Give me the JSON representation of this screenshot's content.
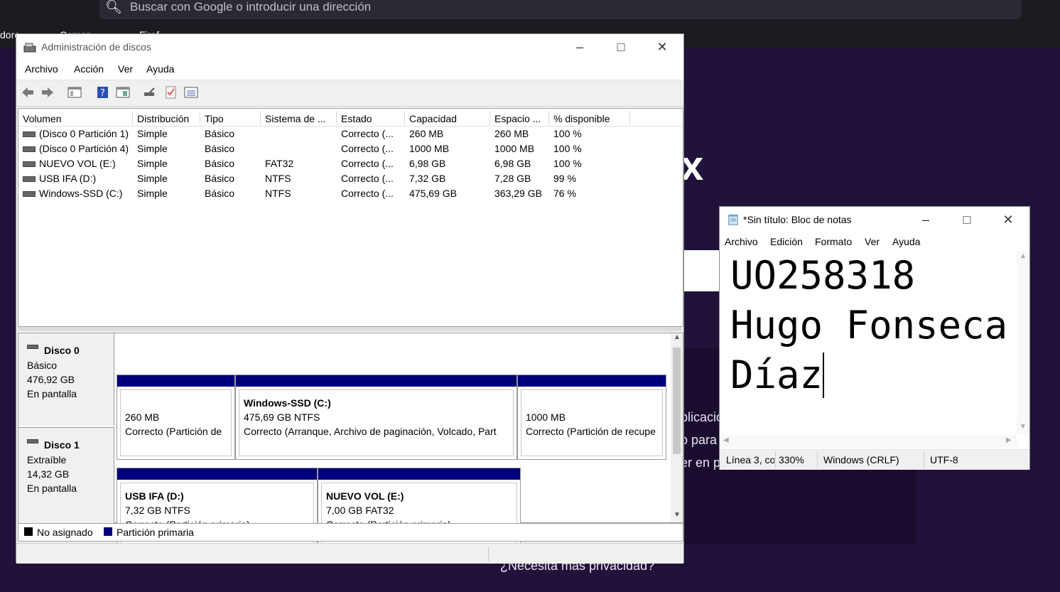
{
  "browser": {
    "search_placeholder": "Buscar con Google o introducir una dirección",
    "bookmark_left": "dore",
    "bookmark_mid": "Comen",
    "bookmark_right": "Firef",
    "bg_letter": "x",
    "bg_line1": "plicació",
    "bg_line2": "o para",
    "bg_line3": "er en p",
    "privacy_text": "¿Necesita más privacidad?"
  },
  "disk_mgmt": {
    "title": "Administración de discos",
    "menu": [
      "Archivo",
      "Acción",
      "Ver",
      "Ayuda"
    ],
    "columns": [
      "Volumen",
      "Distribución",
      "Tipo",
      "Sistema de ...",
      "Estado",
      "Capacidad",
      "Espacio ...",
      "% disponible"
    ],
    "volumes": [
      [
        "(Disco 0 Partición 1)",
        "Simple",
        "Básico",
        "",
        "Correcto (...",
        "260 MB",
        "260 MB",
        "100 %"
      ],
      [
        "(Disco 0 Partición 4)",
        "Simple",
        "Básico",
        "",
        "Correcto (...",
        "1000 MB",
        "1000 MB",
        "100 %"
      ],
      [
        "NUEVO VOL (E:)",
        "Simple",
        "Básico",
        "FAT32",
        "Correcto (...",
        "6,98 GB",
        "6,98 GB",
        "100 %"
      ],
      [
        "USB IFA (D:)",
        "Simple",
        "Básico",
        "NTFS",
        "Correcto (...",
        "7,32 GB",
        "7,28 GB",
        "99 %"
      ],
      [
        "Windows-SSD (C:)",
        "Simple",
        "Básico",
        "NTFS",
        "Correcto (...",
        "475,69 GB",
        "363,29 GB",
        "76 %"
      ]
    ],
    "disk0": {
      "name": "Disco 0",
      "type": "Básico",
      "size": "476,92 GB",
      "status": "En pantalla",
      "p1": {
        "size": "260 MB",
        "status": "Correcto (Partición de"
      },
      "p2": {
        "name": "Windows-SSD  (C:)",
        "size": "475,69 GB NTFS",
        "status": "Correcto (Arranque, Archivo de paginación, Volcado, Part"
      },
      "p3": {
        "size": "1000 MB",
        "status": "Correcto (Partición de recupe"
      }
    },
    "disk1": {
      "name": "Disco 1",
      "type": "Extraíble",
      "size": "14,32 GB",
      "status": "En pantalla",
      "p1": {
        "name": "USB IFA  (D:)",
        "size": "7,32 GB NTFS",
        "status": "Correcto (Partición primaria)"
      },
      "p2": {
        "name": "NUEVO VOL  (E:)",
        "size": "7,00 GB FAT32",
        "status": "Correcto (Partición primaria)"
      }
    },
    "legend": {
      "unallocated": "No asignado",
      "primary": "Partición primaria"
    },
    "colors": {
      "primary": "#00007d",
      "unallocated": "#000000"
    }
  },
  "notepad": {
    "title": "*Sin título: Bloc de notas",
    "menu": [
      "Archivo",
      "Edición",
      "Formato",
      "Ver",
      "Ayuda"
    ],
    "line1": "UO258318",
    "line2": "Hugo Fonseca",
    "line3": "Díaz",
    "status": {
      "position": "Línea 3, co",
      "zoom": "330%",
      "eol": "Windows (CRLF)",
      "encoding": "UTF-8"
    }
  }
}
